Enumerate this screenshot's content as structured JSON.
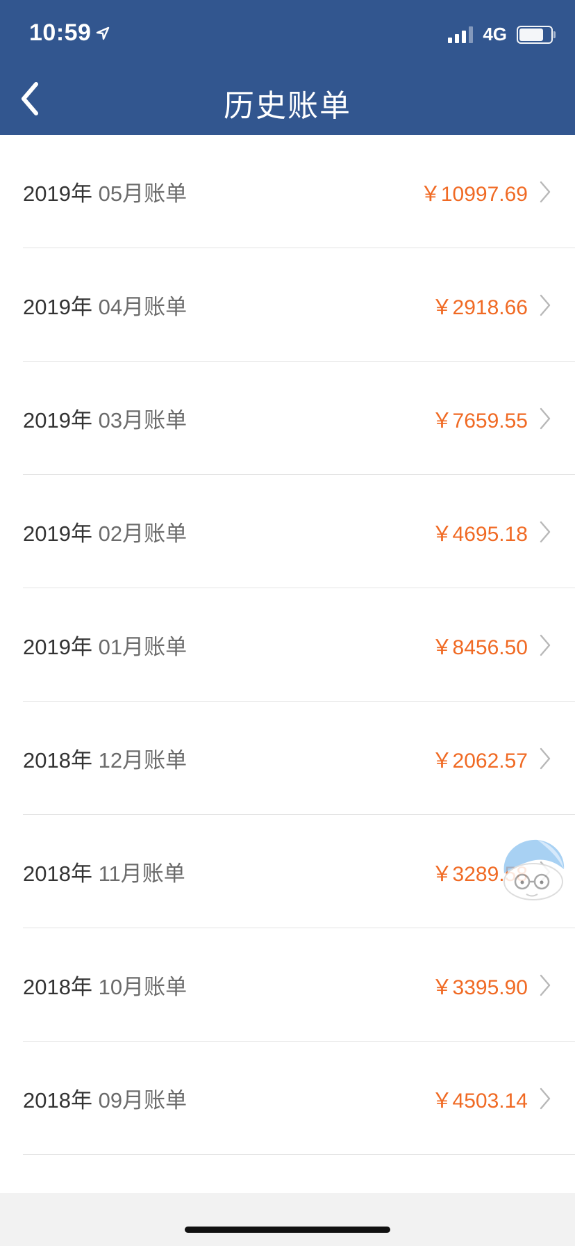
{
  "status_bar": {
    "time": "10:59",
    "network": "4G"
  },
  "nav": {
    "title": "历史账单"
  },
  "bills": [
    {
      "year": "2019年",
      "month": "05月账单",
      "amount": "￥10997.69"
    },
    {
      "year": "2019年",
      "month": "04月账单",
      "amount": "￥2918.66"
    },
    {
      "year": "2019年",
      "month": "03月账单",
      "amount": "￥7659.55"
    },
    {
      "year": "2019年",
      "month": "02月账单",
      "amount": "￥4695.18"
    },
    {
      "year": "2019年",
      "month": "01月账单",
      "amount": "￥8456.50"
    },
    {
      "year": "2018年",
      "month": "12月账单",
      "amount": "￥2062.57"
    },
    {
      "year": "2018年",
      "month": "11月账单",
      "amount": "￥3289.58"
    },
    {
      "year": "2018年",
      "month": "10月账单",
      "amount": "￥3395.90"
    },
    {
      "year": "2018年",
      "month": "09月账单",
      "amount": "￥4503.14"
    }
  ],
  "colors": {
    "header": "#32568f",
    "amount": "#f06a24"
  },
  "icons": {
    "back": "chevron-left-icon",
    "row": "chevron-right-icon"
  }
}
